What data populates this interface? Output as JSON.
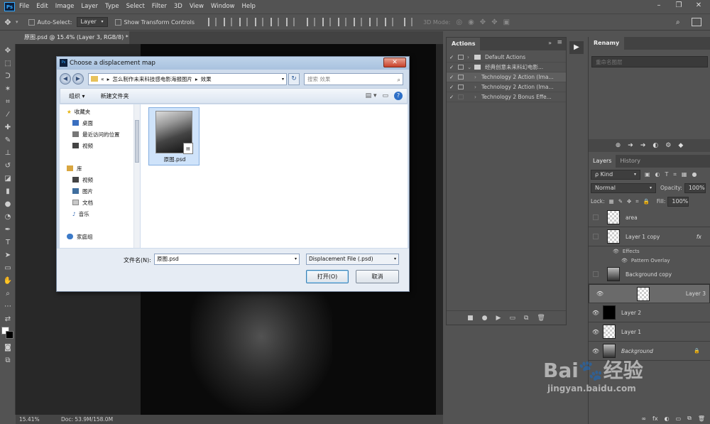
{
  "menubar": {
    "logo": "Ps",
    "items": [
      "File",
      "Edit",
      "Image",
      "Layer",
      "Type",
      "Select",
      "Filter",
      "3D",
      "View",
      "Window",
      "Help"
    ],
    "window_controls": [
      "–",
      "❐",
      "✕"
    ]
  },
  "options": {
    "auto_select_label": "Auto-Select:",
    "auto_select_value": "Layer",
    "show_transform_label": "Show Transform Controls",
    "mode_3d_label": "3D Mode:"
  },
  "document": {
    "tab_title": "原图.psd @ 15.4% (Layer 3, RGB/8) *",
    "tab_close": "×"
  },
  "status": {
    "zoom": "15.41%",
    "doc": "Doc: 53.9M/158.0M"
  },
  "actions": {
    "title": "Actions",
    "rows": [
      {
        "check": "✓",
        "expander": "›",
        "label": "Default Actions",
        "folder": true
      },
      {
        "check": "✓",
        "expander": "⌄",
        "label": "经典创意未来科幻电影...",
        "folder": true
      },
      {
        "check": "✓",
        "expander": "›",
        "label": "Technology 2 Action (Ima...",
        "folder": false
      },
      {
        "check": "✓",
        "expander": "›",
        "label": "Technology 2 Action (Ima...",
        "folder": false
      },
      {
        "check": "✓",
        "expander": "›",
        "label": "Technology 2 Bonus Effe...",
        "folder": false
      }
    ],
    "bottom_icons": [
      "■",
      "●",
      "▶",
      "▭",
      "⧉",
      "🗑"
    ]
  },
  "renamy": {
    "title": "Renamy",
    "placeholder": "重命名图层"
  },
  "layers": {
    "tabs": [
      "Layers",
      "History"
    ],
    "kind_label": "ρ Kind",
    "blend_mode": "Normal",
    "opacity_label": "Opacity:",
    "opacity_value": "100%",
    "lock_label": "Lock:",
    "fill_label": "Fill:",
    "fill_value": "100%",
    "rows": [
      {
        "name": "area",
        "visible": false,
        "thumb": "checker",
        "fx": "",
        "italic": false,
        "lock": ""
      },
      {
        "name": "Layer 1 copy",
        "visible": false,
        "thumb": "checker",
        "fx": "fx",
        "italic": false,
        "lock": ""
      },
      {
        "name": "Background copy",
        "visible": false,
        "thumb": "photo",
        "fx": "",
        "italic": false,
        "lock": ""
      },
      {
        "name": "Layer 3",
        "visible": true,
        "thumb": "checker",
        "fx": "",
        "italic": false,
        "lock": ""
      },
      {
        "name": "Layer 2",
        "visible": true,
        "thumb": "black",
        "fx": "",
        "italic": false,
        "lock": ""
      },
      {
        "name": "Layer 1",
        "visible": true,
        "thumb": "checker",
        "fx": "",
        "italic": false,
        "lock": ""
      },
      {
        "name": "Background",
        "visible": true,
        "thumb": "photo",
        "fx": "",
        "italic": true,
        "lock": "🔒"
      }
    ],
    "effects_label": "Effects",
    "pattern_overlay_label": "Pattern Overlay",
    "bottom_icons": [
      "∞",
      "fx",
      "◐",
      "▭",
      "⧉",
      "🗑"
    ]
  },
  "dialog": {
    "title": "Choose a displacement map",
    "close": "✕",
    "breadcrumb": [
      "«",
      "怎么制作未来科技感电影海报图片",
      "效果"
    ],
    "search_placeholder": "搜索 效果",
    "organize": "组织 ▾",
    "new_folder": "新建文件夹",
    "nav": {
      "favorites": "收藏夹",
      "fav_items": [
        "桌面",
        "最近访问的位置",
        "视频"
      ],
      "libraries": "库",
      "lib_items": [
        "视频",
        "图片",
        "文档",
        "音乐"
      ],
      "homegroup": "家庭组"
    },
    "file": {
      "name": "原图.psd"
    },
    "filename_label": "文件名(N):",
    "filename_value": "原图.psd",
    "filetype_value": "Displacement File (.psd)",
    "open_button": "打开(O)",
    "cancel_button": "取消"
  },
  "watermark": {
    "main": "Bai🐾经验",
    "sub": "jingyan.baidu.com"
  }
}
